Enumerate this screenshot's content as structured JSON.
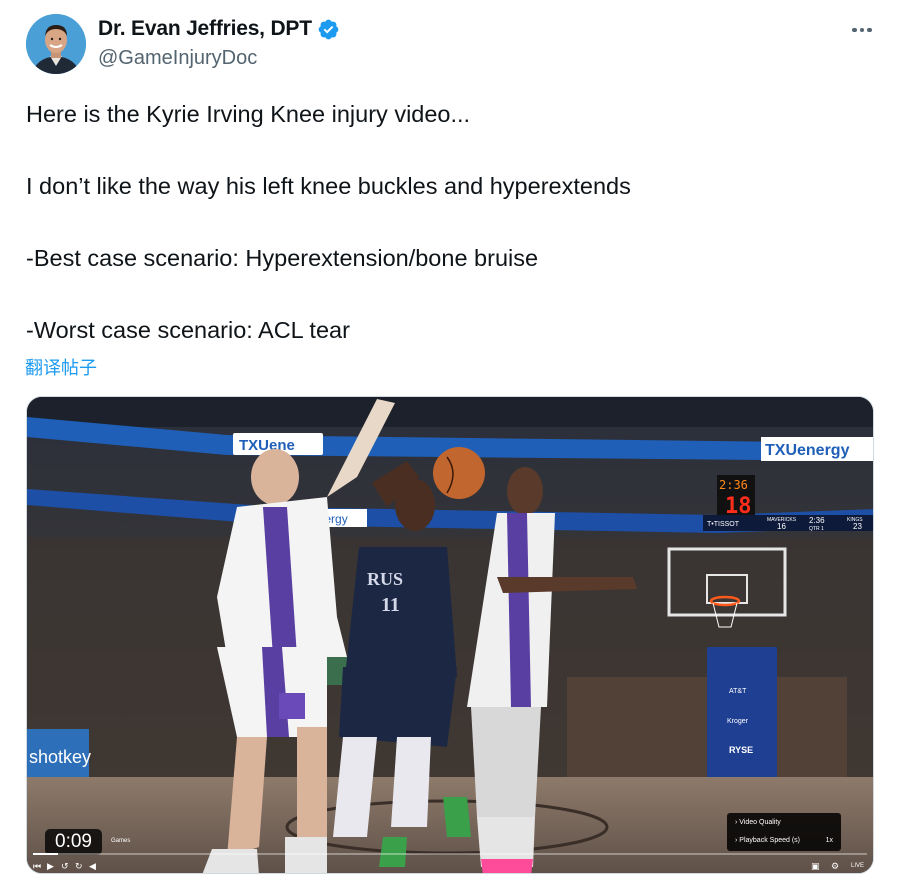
{
  "author": {
    "display_name": "Dr. Evan Jeffries, DPT",
    "handle": "@GameInjuryDoc",
    "verified": true,
    "avatar_bg": "#4a9fd6"
  },
  "more_icon": "more-horizontal-icon",
  "body_lines": [
    "Here is the Kyrie Irving Knee injury video...",
    "I don’t like the way his left knee buckles and hyperextends",
    "-Best case scenario: Hyperextension/bone bruise",
    "-Worst case scenario: ACL tear"
  ],
  "translate_label": "翻译帖子",
  "video": {
    "elapsed": "0:09",
    "progress": 0.03,
    "game_label": "Games",
    "live_label": "LIVE",
    "settings": {
      "quality_label": "Video Quality",
      "speed_label": "Playback Speed (s)",
      "speed_value": "1x"
    },
    "scene_text": {
      "sponsor": "TXUenergy",
      "sponsor_partial": "TXUene",
      "ribbon_partial": "energy",
      "shot_clock": "2:36",
      "shot_clock_num": "18",
      "scoreboard_left": "MAVERICKS",
      "scoreboard_right": "KINGS",
      "score_home": "16",
      "score_away": "23",
      "game_clock": "2:36",
      "quarter": "QTR 1",
      "tissot": "T•TISSOT",
      "jersey_text": "RUS",
      "jersey_number": "11",
      "courtside_partial": "shotkey",
      "courtside_partial2": "tkey",
      "ryse": "RYSE",
      "kroger": "Kroger",
      "att": "AT&T"
    }
  },
  "colors": {
    "link": "#1d9bf0",
    "verified": "#1d9bf0",
    "muted": "#536471",
    "text": "#0f1419"
  }
}
